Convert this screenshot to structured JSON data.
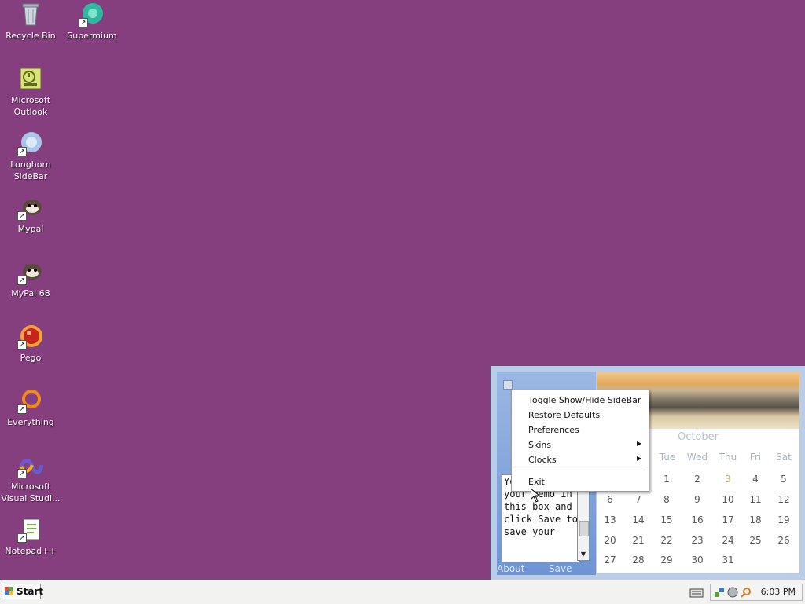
{
  "desktop": {
    "icons": [
      {
        "label": "Recycle Bin",
        "icon": "recycle-bin-icon"
      },
      {
        "label": "Supermium",
        "icon": "supermium-icon"
      },
      {
        "label": "Microsoft Outlook",
        "icon": "outlook-icon"
      },
      {
        "label": "Longhorn SideBar",
        "icon": "longhorn-sidebar-icon"
      },
      {
        "label": "Mypal",
        "icon": "mypal-icon"
      },
      {
        "label": "MyPal 68",
        "icon": "mypal68-icon"
      },
      {
        "label": "Pego",
        "icon": "pego-icon"
      },
      {
        "label": "Everything",
        "icon": "everything-icon"
      },
      {
        "label": "Microsoft Visual Studi...",
        "icon": "visual-studio-icon"
      },
      {
        "label": "Notepad++",
        "icon": "notepadpp-icon"
      }
    ]
  },
  "taskbar": {
    "start_label": "Start",
    "clock": "6:03 PM"
  },
  "sidebar": {
    "memo_text": "You can edit your memo in this box and click Save to save your",
    "about_label": "About",
    "save_label": "Save",
    "calendar": {
      "month": "October",
      "weekdays": [
        "Tue",
        "Wed",
        "Thu",
        "Fri",
        "Sat"
      ],
      "week1": [
        "1",
        "2",
        "3",
        "4",
        "5"
      ],
      "week2": [
        "6",
        "7",
        "8",
        "9",
        "10",
        "11",
        "12"
      ],
      "week3": [
        "13",
        "14",
        "15",
        "16",
        "17",
        "18",
        "19"
      ],
      "week4": [
        "20",
        "21",
        "22",
        "23",
        "24",
        "25",
        "26"
      ],
      "week5": [
        "27",
        "28",
        "29",
        "30",
        "31"
      ],
      "highlight_color": "#c7b24a"
    }
  },
  "context_menu": {
    "items": [
      {
        "label": "Toggle Show/Hide SideBar"
      },
      {
        "label": "Restore Defaults"
      },
      {
        "label": "Preferences"
      },
      {
        "label": "Skins",
        "submenu": true
      },
      {
        "label": "Clocks",
        "submenu": true
      },
      {
        "label": "Exit"
      }
    ]
  },
  "colors": {
    "desktop_bg": "#863f7e",
    "sidebar_bg": "#b9cde8",
    "memo_panel": "#7fa2da"
  }
}
